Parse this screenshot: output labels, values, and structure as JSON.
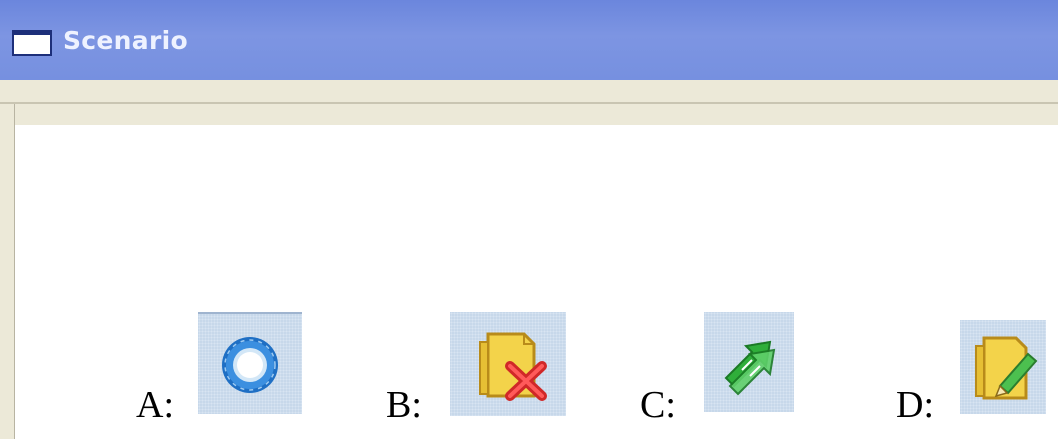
{
  "window": {
    "title": "Scenario",
    "icon": "window-icon"
  },
  "options": [
    {
      "label": "A:",
      "icon": "blue-ring-icon"
    },
    {
      "label": "B:",
      "icon": "document-delete-icon"
    },
    {
      "label": "C:",
      "icon": "green-swap-arrows-icon"
    },
    {
      "label": "D:",
      "icon": "document-edit-icon"
    }
  ],
  "colors": {
    "titlebar": "#7690e0",
    "frame": "#ece9d8",
    "icon_background": "#c7d8ea"
  }
}
